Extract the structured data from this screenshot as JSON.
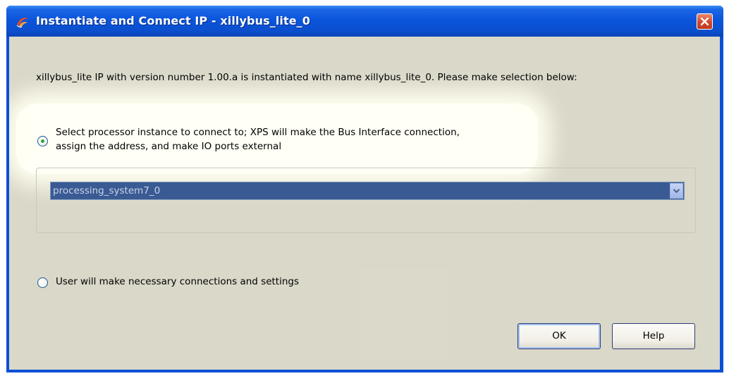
{
  "window": {
    "title": "Instantiate and Connect IP - xillybus_lite_0",
    "icons": {
      "app": "xilinx-app-icon",
      "close": "close-icon"
    }
  },
  "dialog": {
    "info_text": "xillybus_lite IP with version number 1.00.a is instantiated with name xillybus_lite_0. Please make selection below:",
    "option_processor": {
      "label_line1": "Select processor instance to connect to; XPS will make the Bus Interface connection,",
      "label_line2": "assign the address, and make IO ports external",
      "selected": true
    },
    "processor_select": {
      "value": "processing_system7_0"
    },
    "option_manual": {
      "label": "User will make necessary connections and settings",
      "selected": false
    }
  },
  "buttons": {
    "ok": "OK",
    "help": "Help"
  },
  "colors": {
    "title_bar": "#0a55db",
    "client_bg": "#ebe9d9",
    "radio_dot": "#2ea53a",
    "combo_selected_bg": "#3a5a94",
    "close_button": "#d2462a"
  }
}
